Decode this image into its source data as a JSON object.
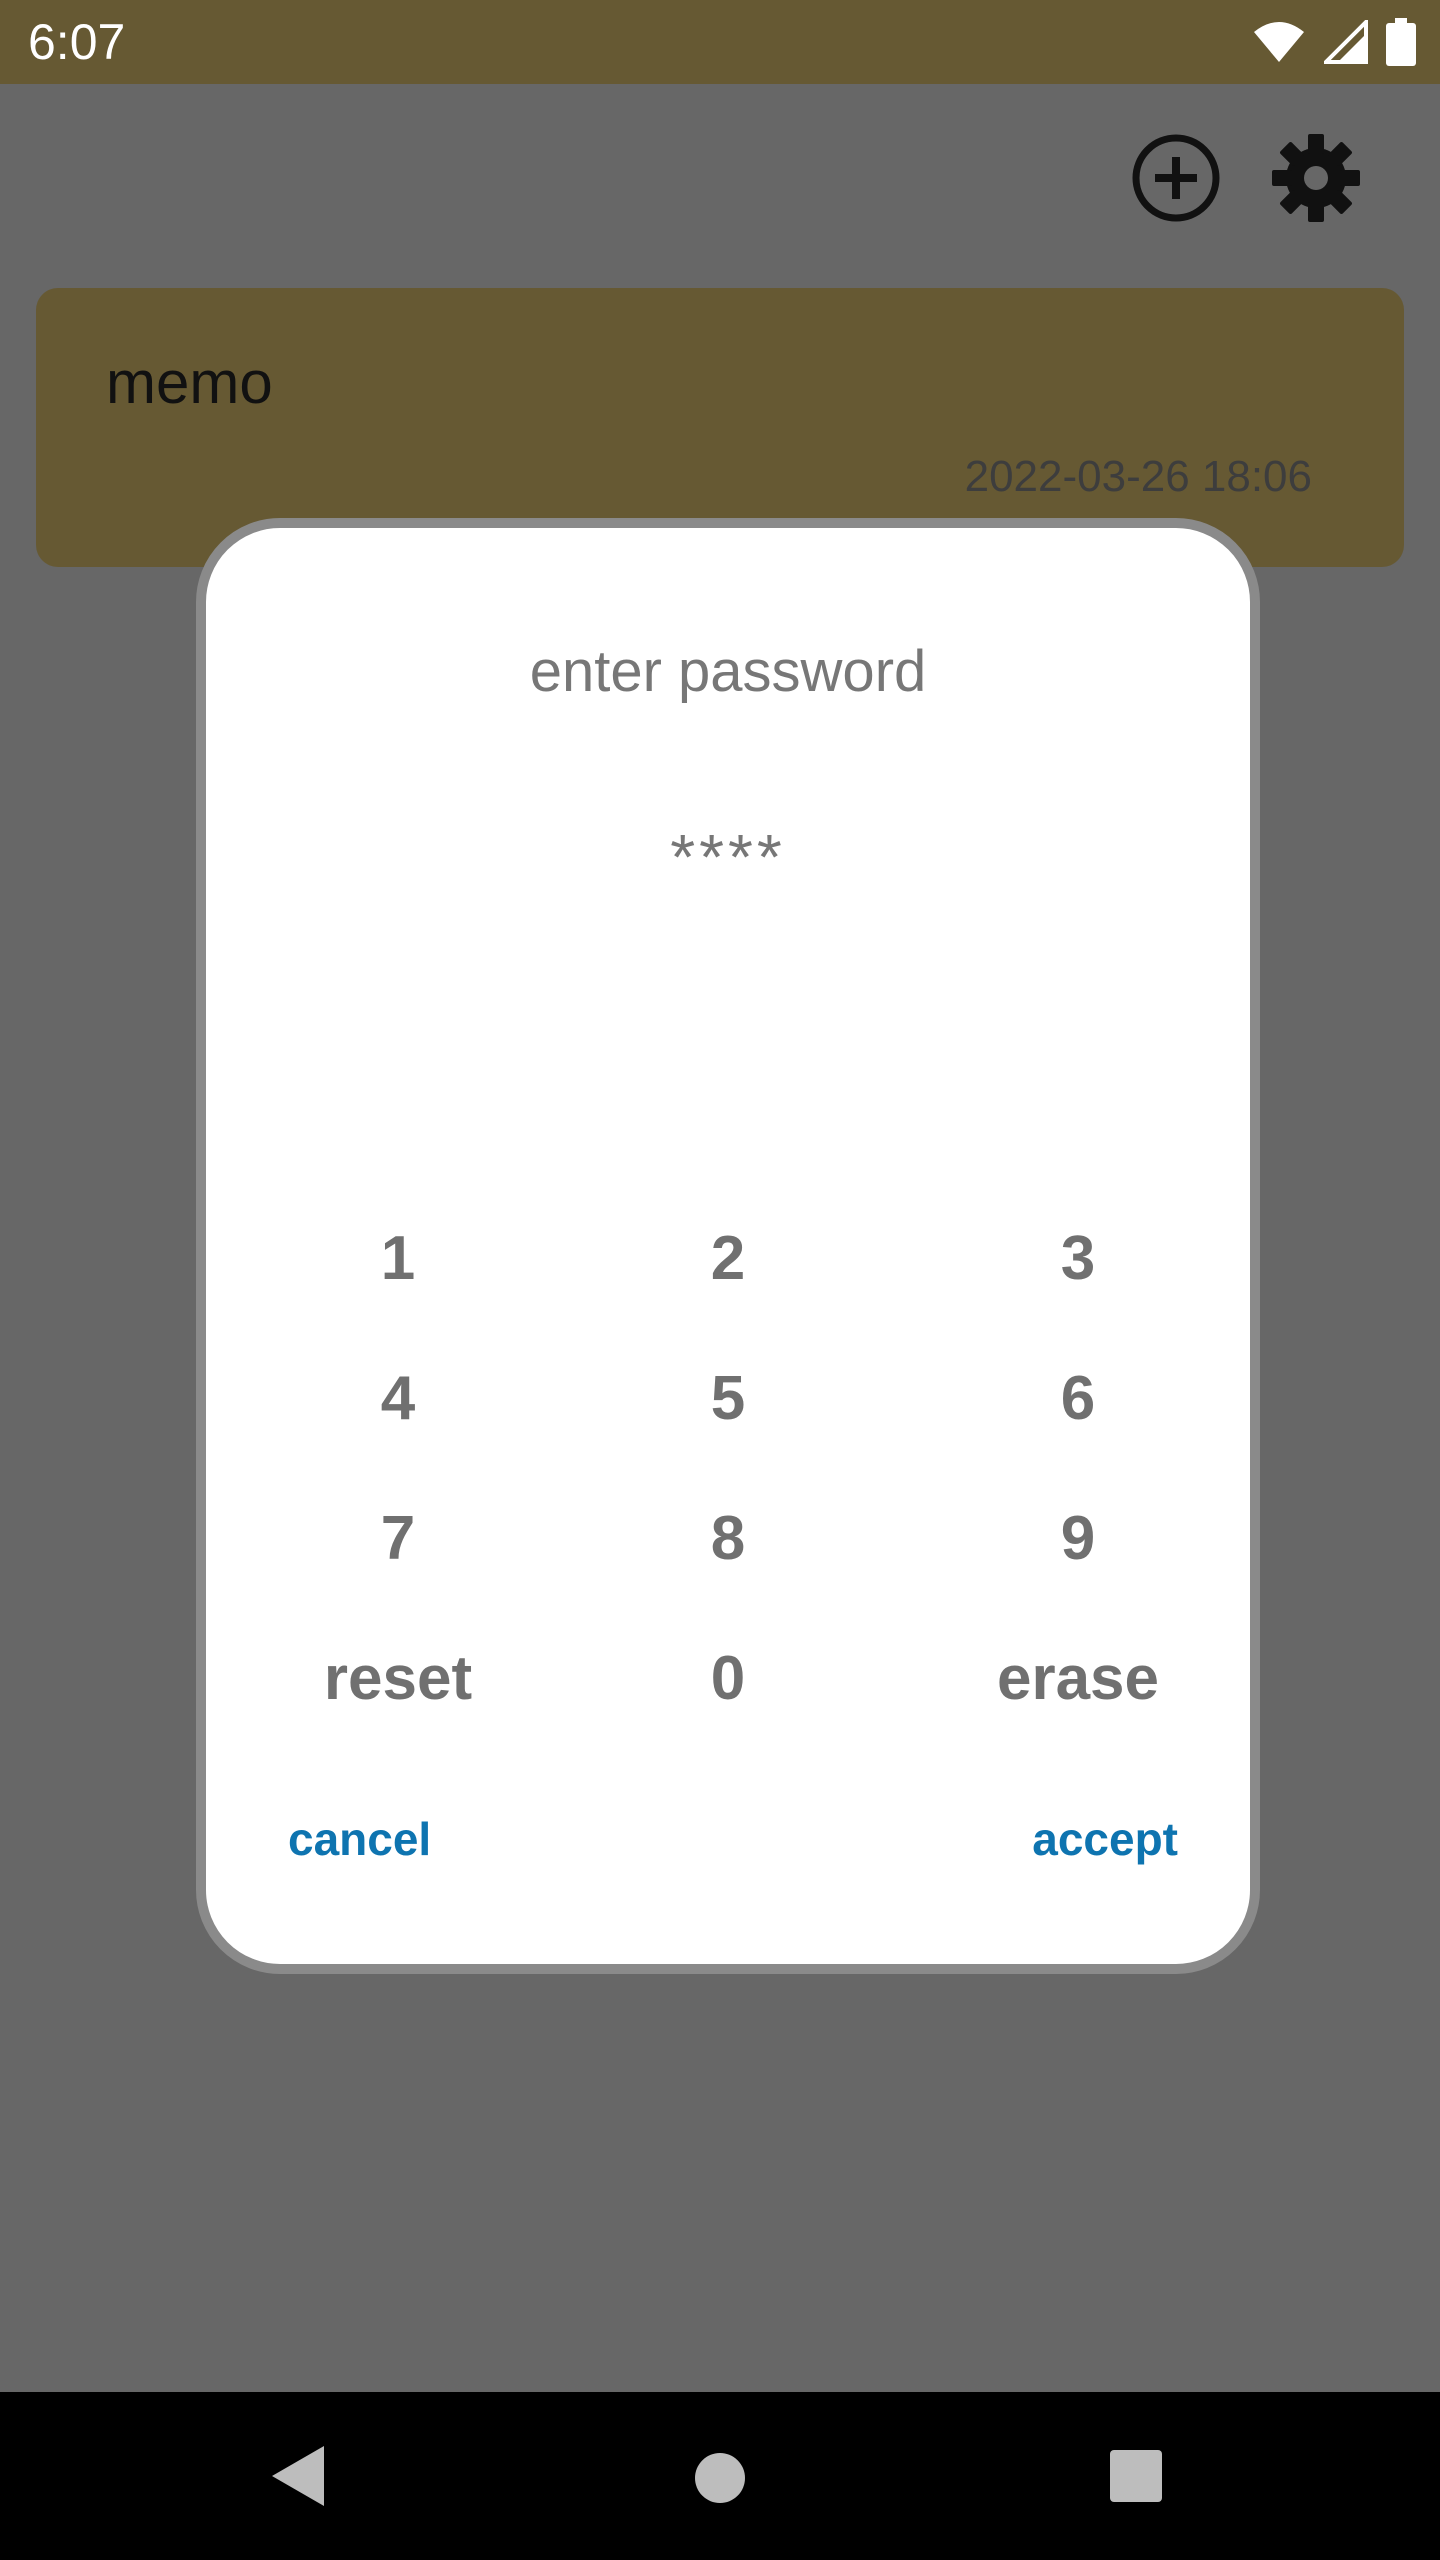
{
  "status_bar": {
    "time": "6:07",
    "icons": [
      "wifi-icon",
      "signal-icon",
      "battery-icon"
    ]
  },
  "toolbar": {
    "add_icon": "add-circle-icon",
    "settings_icon": "gear-icon"
  },
  "memo": {
    "title": "memo",
    "date": "2022-03-26 18:06"
  },
  "dialog": {
    "title": "enter password",
    "password_mask": "****",
    "keys": [
      [
        "1",
        "2",
        "3"
      ],
      [
        "4",
        "5",
        "6"
      ],
      [
        "7",
        "8",
        "9"
      ],
      [
        "reset",
        "0",
        "erase"
      ]
    ],
    "cancel_label": "cancel",
    "accept_label": "accept"
  },
  "nav": {
    "back_icon": "back-triangle-icon",
    "home_icon": "home-circle-icon",
    "recents_icon": "recents-square-icon"
  },
  "colors": {
    "accent_brown": "#665933",
    "overlay_gray": "#676767",
    "button_blue": "#0e74b0"
  }
}
